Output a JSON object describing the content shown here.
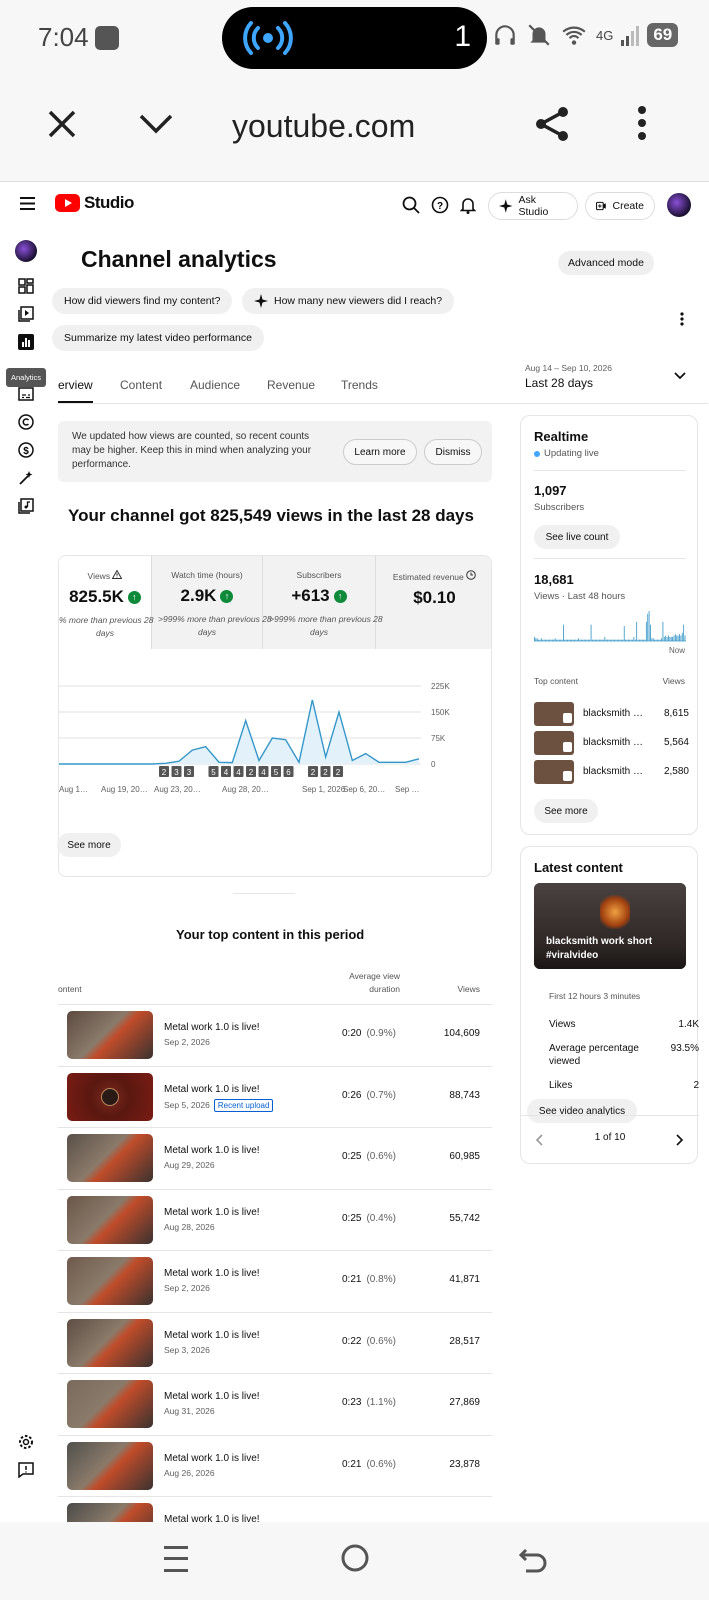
{
  "status": {
    "time": "7:04",
    "count": "1",
    "network": "4G",
    "battery": "69"
  },
  "browser": {
    "url": "youtube.com"
  },
  "studio": {
    "logo": "Studio",
    "ask": "Ask Studio",
    "create": "Create"
  },
  "sidebar": {
    "tooltip": "Analytics"
  },
  "page": {
    "title": "Channel analytics",
    "advanced": "Advanced mode",
    "chips": [
      "How did viewers find my content?",
      "How many new viewers did I reach?",
      "Summarize my latest video performance"
    ]
  },
  "tabs": [
    "erview",
    "Content",
    "Audience",
    "Revenue",
    "Trends"
  ],
  "range": {
    "dates": "Aug 14 – Sep 10, 2026",
    "label": "Last 28 days"
  },
  "banner": {
    "text": "We updated how views are counted, so recent counts may be higher. Keep this in mind when analyzing your performance.",
    "learn": "Learn more",
    "dismiss": "Dismiss"
  },
  "headline": "Your channel got 825,549 views in the last 28 days",
  "metrics": [
    {
      "label": "Views",
      "value": "825.5K",
      "note": "% more than previous 28",
      "note2": "days"
    },
    {
      "label": "Watch time (hours)",
      "value": "2.9K",
      "note": ">999% more than previous 28",
      "note2": "days"
    },
    {
      "label": "Subscribers",
      "value": "+613",
      "note": ">999% more than previous 28",
      "note2": "days"
    },
    {
      "label": "Estimated revenue",
      "value": "$0.10",
      "note": "",
      "note2": ""
    }
  ],
  "chart_data": {
    "type": "area",
    "title": "",
    "xlabel": "",
    "ylabel": "",
    "x": [
      "Aug 14",
      "Aug 15",
      "Aug 16",
      "Aug 17",
      "Aug 18",
      "Aug 19",
      "Aug 20",
      "Aug 21",
      "Aug 22",
      "Aug 23",
      "Aug 24",
      "Aug 25",
      "Aug 26",
      "Aug 27",
      "Aug 28",
      "Aug 29",
      "Aug 30",
      "Aug 31",
      "Sep 1",
      "Sep 2",
      "Sep 3",
      "Sep 4",
      "Sep 5",
      "Sep 6",
      "Sep 7",
      "Sep 8",
      "Sep 9",
      "Sep 10"
    ],
    "values": [
      0,
      0,
      0,
      0,
      0,
      0,
      0,
      0,
      2000,
      8000,
      40000,
      50000,
      5000,
      4000,
      125000,
      10000,
      75000,
      70000,
      5000,
      185000,
      20000,
      150000,
      10000,
      30000,
      5000,
      5000,
      5000,
      15000
    ],
    "ylim": [
      0,
      225000
    ],
    "yticks": [
      "225K",
      "150K",
      "75K",
      "0"
    ],
    "xticks": [
      "Aug 1…",
      "Aug 19, 20…",
      "Aug 23, 20…",
      "Aug 28, 20…",
      "Sep 1, 2026",
      "Sep 6, 20…",
      "Sep …"
    ],
    "markers": [
      "2",
      "3",
      "3",
      "5",
      "4",
      "4",
      "2",
      "4",
      "5",
      "6",
      "2",
      "2",
      "2"
    ]
  },
  "see_more": "See more",
  "top": {
    "title": "Your top content in this period",
    "col_content": "ontent",
    "col_avd": "Average view",
    "col_avd2": "duration",
    "col_views": "Views",
    "rows": [
      {
        "title": "Metal work 1.0 is live!",
        "date": "Sep 2, 2026",
        "badge": "",
        "avd": "0:20",
        "pct": "(0.9%)",
        "views": "104,609"
      },
      {
        "title": "Metal work 1.0 is live!",
        "date": "Sep 5, 2026",
        "badge": "Recent upload",
        "avd": "0:26",
        "pct": "(0.7%)",
        "views": "88,743"
      },
      {
        "title": "Metal work 1.0 is live!",
        "date": "Aug 29, 2026",
        "badge": "",
        "avd": "0:25",
        "pct": "(0.6%)",
        "views": "60,985"
      },
      {
        "title": "Metal work 1.0 is live!",
        "date": "Aug 28, 2026",
        "badge": "",
        "avd": "0:25",
        "pct": "(0.4%)",
        "views": "55,742"
      },
      {
        "title": "Metal work 1.0 is live!",
        "date": "Sep 2, 2026",
        "badge": "",
        "avd": "0:21",
        "pct": "(0.8%)",
        "views": "41,871"
      },
      {
        "title": "Metal work 1.0 is live!",
        "date": "Sep 3, 2026",
        "badge": "",
        "avd": "0:22",
        "pct": "(0.6%)",
        "views": "28,517"
      },
      {
        "title": "Metal work 1.0 is live!",
        "date": "Aug 31, 2026",
        "badge": "",
        "avd": "0:23",
        "pct": "(1.1%)",
        "views": "27,869"
      },
      {
        "title": "Metal work 1.0 is live!",
        "date": "Aug 26, 2026",
        "badge": "",
        "avd": "0:21",
        "pct": "(0.6%)",
        "views": "23,878"
      },
      {
        "title": "Metal work 1.0 is live!",
        "date": "",
        "badge": "",
        "avd": "",
        "pct": "",
        "views": ""
      }
    ]
  },
  "realtime": {
    "title": "Realtime",
    "live": "Updating live",
    "subs": "1,097",
    "subs_label": "Subscribers",
    "see_live": "See live count",
    "views": "18,681",
    "views_label": "Views · Last 48 hours",
    "now": "Now",
    "top_label": "Top content",
    "views_col": "Views",
    "bars": [
      3,
      2,
      2,
      1,
      1,
      2,
      1,
      1,
      1,
      1,
      1,
      1,
      1,
      1,
      1,
      2,
      1,
      1,
      1,
      1,
      1,
      12,
      1,
      1,
      1,
      1,
      1,
      1,
      1,
      1,
      1,
      1,
      2,
      1,
      1,
      1,
      1,
      1,
      1,
      1,
      1,
      12,
      1,
      1,
      1,
      1,
      1,
      1,
      1,
      1,
      1,
      3,
      1,
      1,
      1,
      1,
      1,
      1,
      1,
      1,
      1,
      1,
      1,
      1,
      1,
      11,
      1,
      1,
      1,
      1,
      1,
      1,
      3,
      1,
      14,
      1,
      1,
      1,
      1,
      1,
      1,
      14,
      20,
      22,
      12,
      2,
      2,
      1,
      1,
      1,
      1,
      1,
      2,
      14,
      3,
      4,
      3,
      4,
      3,
      3,
      3,
      4,
      5,
      4,
      4,
      5,
      4,
      6,
      12,
      4
    ],
    "items": [
      {
        "name": "blacksmith …",
        "views": "8,615"
      },
      {
        "name": "blacksmith …",
        "views": "5,564"
      },
      {
        "name": "blacksmith …",
        "views": "2,580"
      }
    ],
    "see_more": "See more"
  },
  "latest": {
    "title": "Latest content",
    "caption": "blacksmith work short #viralvideo",
    "period": "First 12 hours 3 minutes",
    "stats": [
      {
        "label": "Views",
        "value": "1.4K"
      },
      {
        "label": "Average percentage viewed",
        "value": "93.5%"
      },
      {
        "label": "Likes",
        "value": "2"
      }
    ],
    "button": "See video analytics",
    "pager": "1 of 10"
  },
  "colors": {
    "accent": "#3ea6ff",
    "youtube_red": "#ff0000",
    "positive": "#0e8a3a"
  }
}
